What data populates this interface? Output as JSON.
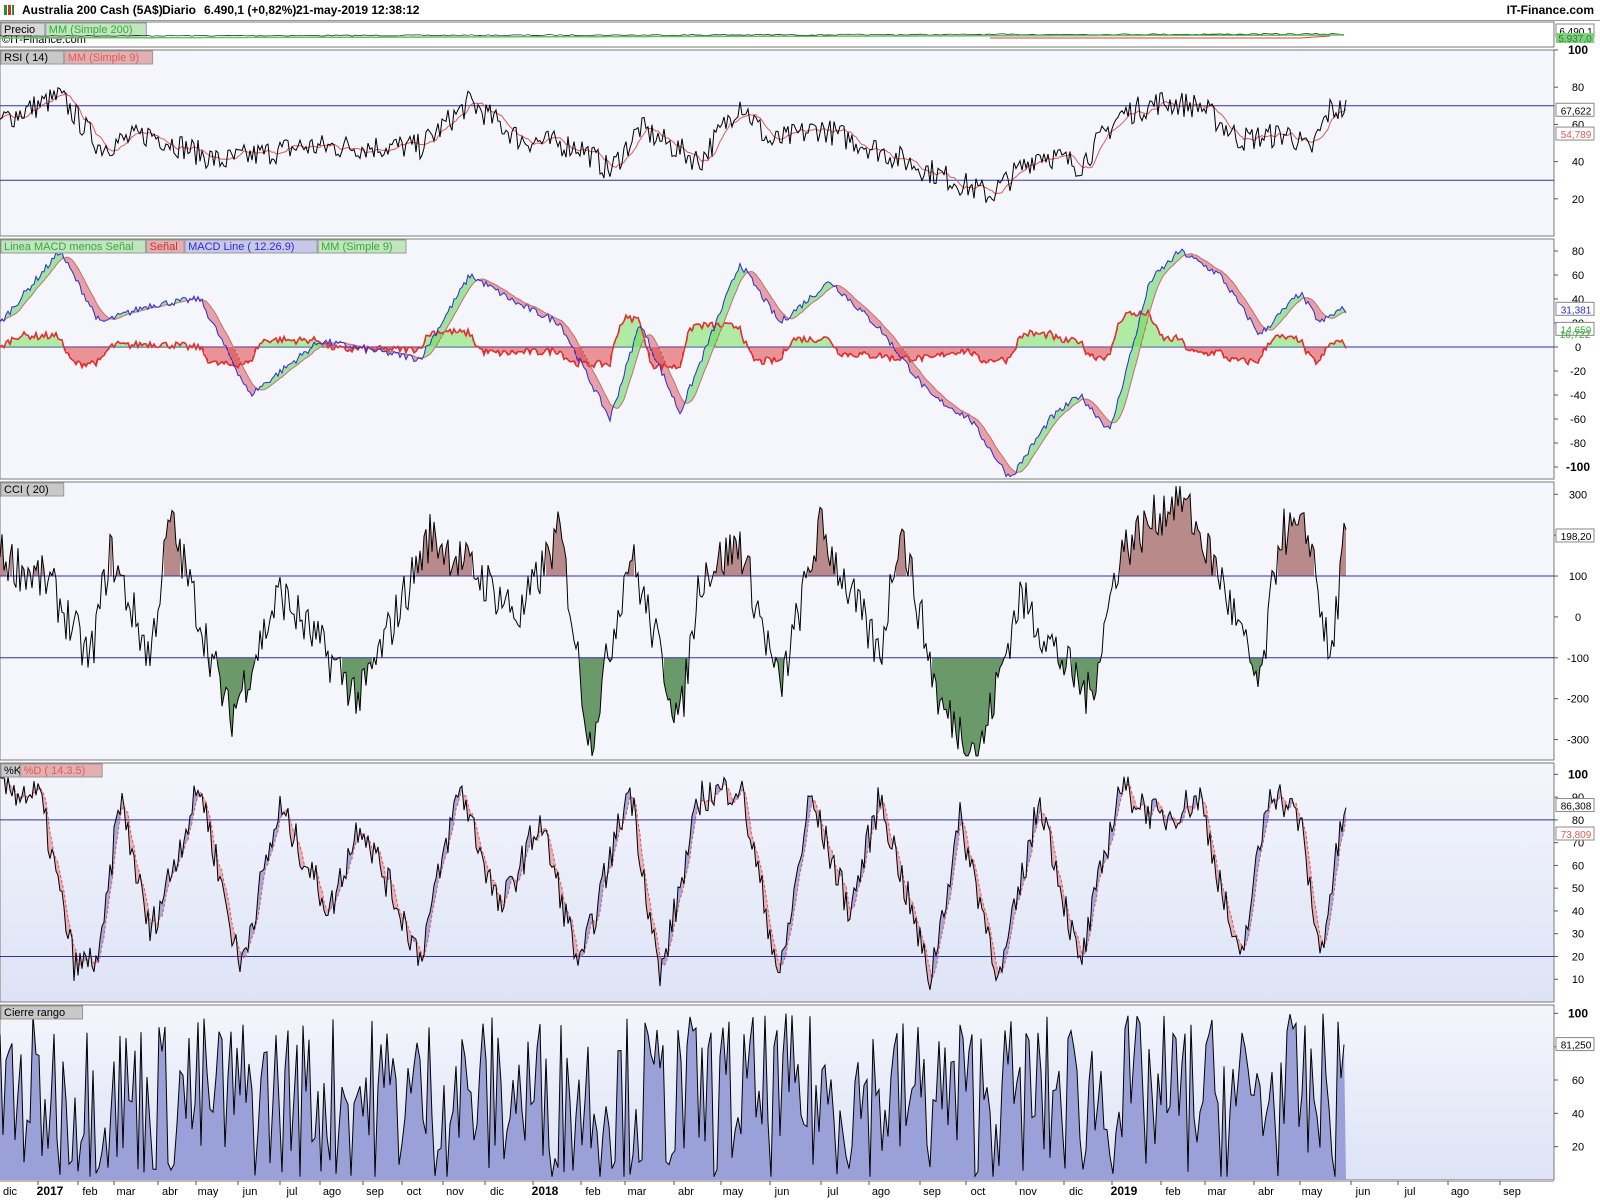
{
  "header": {
    "instrument": "Australia 200 Cash (5A$)",
    "period": "Diario",
    "last_change": "6.490,1 (+0,82%)",
    "datetime": "21-may-2019 12:38:12",
    "site": "IT-Finance.com",
    "copyright": "©IT-Finance.com"
  },
  "colors": {
    "panel_bg": "#f4f6fc",
    "panel_bg_bottom": "#dde3f6",
    "rsi_line": "#000000",
    "rsi_ma": "#e05a5a",
    "macd_line": "#2b2bd6",
    "macd_signal": "#e03030",
    "macd_hist_pos": "#6be04a",
    "macd_hist_neg": "#e03030",
    "fill_up": "#9ee49e",
    "fill_down": "#e8a0a8",
    "cci_over": "#b88a8a",
    "cci_under": "#6a9a6a",
    "stoch_k": "#000000",
    "stoch_d": "#e05a5a",
    "range_fill": "#9aa0d8",
    "level_line": "#3030a8"
  },
  "chart_data": [
    {
      "panel": "Precio",
      "type": "line",
      "legend": [
        "Precio",
        "MM (Simple 200)"
      ],
      "last_value_label": "6.490,1",
      "secondary_label": "5.937,0"
    },
    {
      "panel": "RSI",
      "type": "line",
      "legend": [
        "RSI ( 14)",
        "MM (Simple 9)"
      ],
      "levels": [
        70,
        30
      ],
      "ylim": [
        0,
        100
      ],
      "yticks": [
        20,
        40,
        60,
        80,
        100
      ],
      "last_values": {
        "rsi": "67,622",
        "ma": "54,789"
      },
      "keypoints": [
        [
          0,
          62
        ],
        [
          60,
          75
        ],
        [
          100,
          48
        ],
        [
          150,
          55
        ],
        [
          220,
          40
        ],
        [
          300,
          48
        ],
        [
          420,
          48
        ],
        [
          470,
          72
        ],
        [
          520,
          52
        ],
        [
          580,
          48
        ],
        [
          610,
          35
        ],
        [
          640,
          58
        ],
        [
          700,
          40
        ],
        [
          740,
          72
        ],
        [
          770,
          50
        ],
        [
          820,
          58
        ],
        [
          870,
          48
        ],
        [
          930,
          35
        ],
        [
          990,
          22
        ],
        [
          1040,
          45
        ],
        [
          1080,
          38
        ],
        [
          1120,
          65
        ],
        [
          1160,
          72
        ],
        [
          1200,
          70
        ],
        [
          1240,
          52
        ],
        [
          1290,
          55
        ],
        [
          1310,
          45
        ],
        [
          1330,
          68
        ]
      ]
    },
    {
      "panel": "MACD",
      "type": "line",
      "legend": [
        "Linea MACD menos Señal",
        "Señal",
        "MACD Line ( 12.26.9)",
        "MM (Simple 9)"
      ],
      "ylim": [
        -110,
        90
      ],
      "yticks": [
        80,
        60,
        40,
        20,
        0,
        -20,
        -40,
        -60,
        -80,
        -100
      ],
      "last_values": {
        "macd": "31,381",
        "signal": "14,659",
        "hist": "16,722"
      },
      "keypoints": [
        [
          0,
          20
        ],
        [
          60,
          80
        ],
        [
          100,
          20
        ],
        [
          150,
          35
        ],
        [
          200,
          40
        ],
        [
          250,
          -40
        ],
        [
          320,
          5
        ],
        [
          420,
          -10
        ],
        [
          470,
          60
        ],
        [
          520,
          35
        ],
        [
          560,
          20
        ],
        [
          610,
          -60
        ],
        [
          640,
          20
        ],
        [
          680,
          -55
        ],
        [
          740,
          70
        ],
        [
          780,
          20
        ],
        [
          830,
          55
        ],
        [
          880,
          15
        ],
        [
          930,
          -40
        ],
        [
          970,
          -60
        ],
        [
          1010,
          -110
        ],
        [
          1050,
          -60
        ],
        [
          1080,
          -40
        ],
        [
          1110,
          -70
        ],
        [
          1150,
          55
        ],
        [
          1180,
          80
        ],
        [
          1220,
          60
        ],
        [
          1260,
          10
        ],
        [
          1300,
          45
        ],
        [
          1320,
          20
        ],
        [
          1340,
          31
        ]
      ]
    },
    {
      "panel": "CCI",
      "type": "line",
      "legend": [
        "CCI ( 20)"
      ],
      "levels": [
        100,
        -100
      ],
      "ylim": [
        -350,
        330
      ],
      "yticks": [
        300,
        200,
        100,
        0,
        -100,
        -200,
        -300
      ],
      "last_values": {
        "cci": "198,20"
      },
      "keypoints": [
        [
          0,
          150
        ],
        [
          50,
          80
        ],
        [
          90,
          -110
        ],
        [
          110,
          160
        ],
        [
          150,
          -100
        ],
        [
          170,
          240
        ],
        [
          230,
          -250
        ],
        [
          280,
          60
        ],
        [
          360,
          -200
        ],
        [
          430,
          200
        ],
        [
          480,
          100
        ],
        [
          520,
          0
        ],
        [
          560,
          210
        ],
        [
          590,
          -310
        ],
        [
          630,
          160
        ],
        [
          680,
          -260
        ],
        [
          700,
          100
        ],
        [
          740,
          180
        ],
        [
          780,
          -180
        ],
        [
          820,
          220
        ],
        [
          880,
          -100
        ],
        [
          900,
          230
        ],
        [
          940,
          -220
        ],
        [
          980,
          -330
        ],
        [
          1020,
          50
        ],
        [
          1060,
          -100
        ],
        [
          1090,
          -200
        ],
        [
          1120,
          160
        ],
        [
          1180,
          300
        ],
        [
          1220,
          100
        ],
        [
          1260,
          -180
        ],
        [
          1280,
          210
        ],
        [
          1310,
          200
        ],
        [
          1330,
          -120
        ],
        [
          1345,
          198
        ]
      ]
    },
    {
      "panel": "Stochastic",
      "type": "line",
      "legend": [
        "%K",
        "%D ( 14.3.5)"
      ],
      "levels": [
        80,
        20
      ],
      "ylim": [
        0,
        105
      ],
      "yticks": [
        10,
        20,
        30,
        40,
        50,
        60,
        70,
        80,
        90,
        100
      ],
      "last_values": {
        "k": "86,308",
        "d": "73,809"
      },
      "keypoints": [
        [
          0,
          95
        ],
        [
          40,
          90
        ],
        [
          75,
          15
        ],
        [
          100,
          20
        ],
        [
          120,
          90
        ],
        [
          150,
          30
        ],
        [
          200,
          95
        ],
        [
          240,
          15
        ],
        [
          280,
          85
        ],
        [
          330,
          40
        ],
        [
          360,
          80
        ],
        [
          420,
          20
        ],
        [
          460,
          95
        ],
        [
          500,
          40
        ],
        [
          540,
          80
        ],
        [
          580,
          15
        ],
        [
          630,
          95
        ],
        [
          660,
          10
        ],
        [
          700,
          90
        ],
        [
          740,
          95
        ],
        [
          780,
          10
        ],
        [
          810,
          90
        ],
        [
          850,
          40
        ],
        [
          880,
          90
        ],
        [
          930,
          10
        ],
        [
          960,
          80
        ],
        [
          1000,
          10
        ],
        [
          1040,
          90
        ],
        [
          1080,
          15
        ],
        [
          1120,
          95
        ],
        [
          1160,
          80
        ],
        [
          1200,
          90
        ],
        [
          1240,
          15
        ],
        [
          1270,
          95
        ],
        [
          1300,
          80
        ],
        [
          1320,
          20
        ],
        [
          1345,
          86
        ]
      ]
    },
    {
      "panel": "Cierre rango",
      "type": "area",
      "legend": [
        "Cierre rango"
      ],
      "ylim": [
        0,
        105
      ],
      "yticks": [
        20,
        40,
        60,
        80,
        100
      ],
      "last_values": {
        "value": "81,250"
      }
    }
  ],
  "x_axis": {
    "labels": [
      {
        "t": "dic",
        "x": 10,
        "bold": false
      },
      {
        "t": "2017",
        "x": 50,
        "bold": true
      },
      {
        "t": "feb",
        "x": 90,
        "bold": false
      },
      {
        "t": "mar",
        "x": 126,
        "bold": false
      },
      {
        "t": "abr",
        "x": 170,
        "bold": false
      },
      {
        "t": "may",
        "x": 208,
        "bold": false
      },
      {
        "t": "jun",
        "x": 250,
        "bold": false
      },
      {
        "t": "jul",
        "x": 292,
        "bold": false
      },
      {
        "t": "ago",
        "x": 332,
        "bold": false
      },
      {
        "t": "sep",
        "x": 375,
        "bold": false
      },
      {
        "t": "oct",
        "x": 414,
        "bold": false
      },
      {
        "t": "nov",
        "x": 455,
        "bold": false
      },
      {
        "t": "dic",
        "x": 497,
        "bold": false
      },
      {
        "t": "2018",
        "x": 545,
        "bold": true
      },
      {
        "t": "feb",
        "x": 593,
        "bold": false
      },
      {
        "t": "mar",
        "x": 637,
        "bold": false
      },
      {
        "t": "abr",
        "x": 686,
        "bold": false
      },
      {
        "t": "may",
        "x": 733,
        "bold": false
      },
      {
        "t": "jun",
        "x": 782,
        "bold": false
      },
      {
        "t": "jul",
        "x": 833,
        "bold": false
      },
      {
        "t": "ago",
        "x": 881,
        "bold": false
      },
      {
        "t": "sep",
        "x": 932,
        "bold": false
      },
      {
        "t": "oct",
        "x": 978,
        "bold": false
      },
      {
        "t": "nov",
        "x": 1028,
        "bold": false
      },
      {
        "t": "dic",
        "x": 1076,
        "bold": false
      },
      {
        "t": "2019",
        "x": 1124,
        "bold": true
      },
      {
        "t": "feb",
        "x": 1173,
        "bold": false
      },
      {
        "t": "mar",
        "x": 1217,
        "bold": false
      },
      {
        "t": "abr",
        "x": 1266,
        "bold": false
      },
      {
        "t": "may",
        "x": 1312,
        "bold": false
      },
      {
        "t": "jun",
        "x": 1363,
        "bold": false
      },
      {
        "t": "jul",
        "x": 1410,
        "bold": false
      },
      {
        "t": "ago",
        "x": 1460,
        "bold": false
      },
      {
        "t": "sep",
        "x": 1512,
        "bold": false
      }
    ]
  }
}
